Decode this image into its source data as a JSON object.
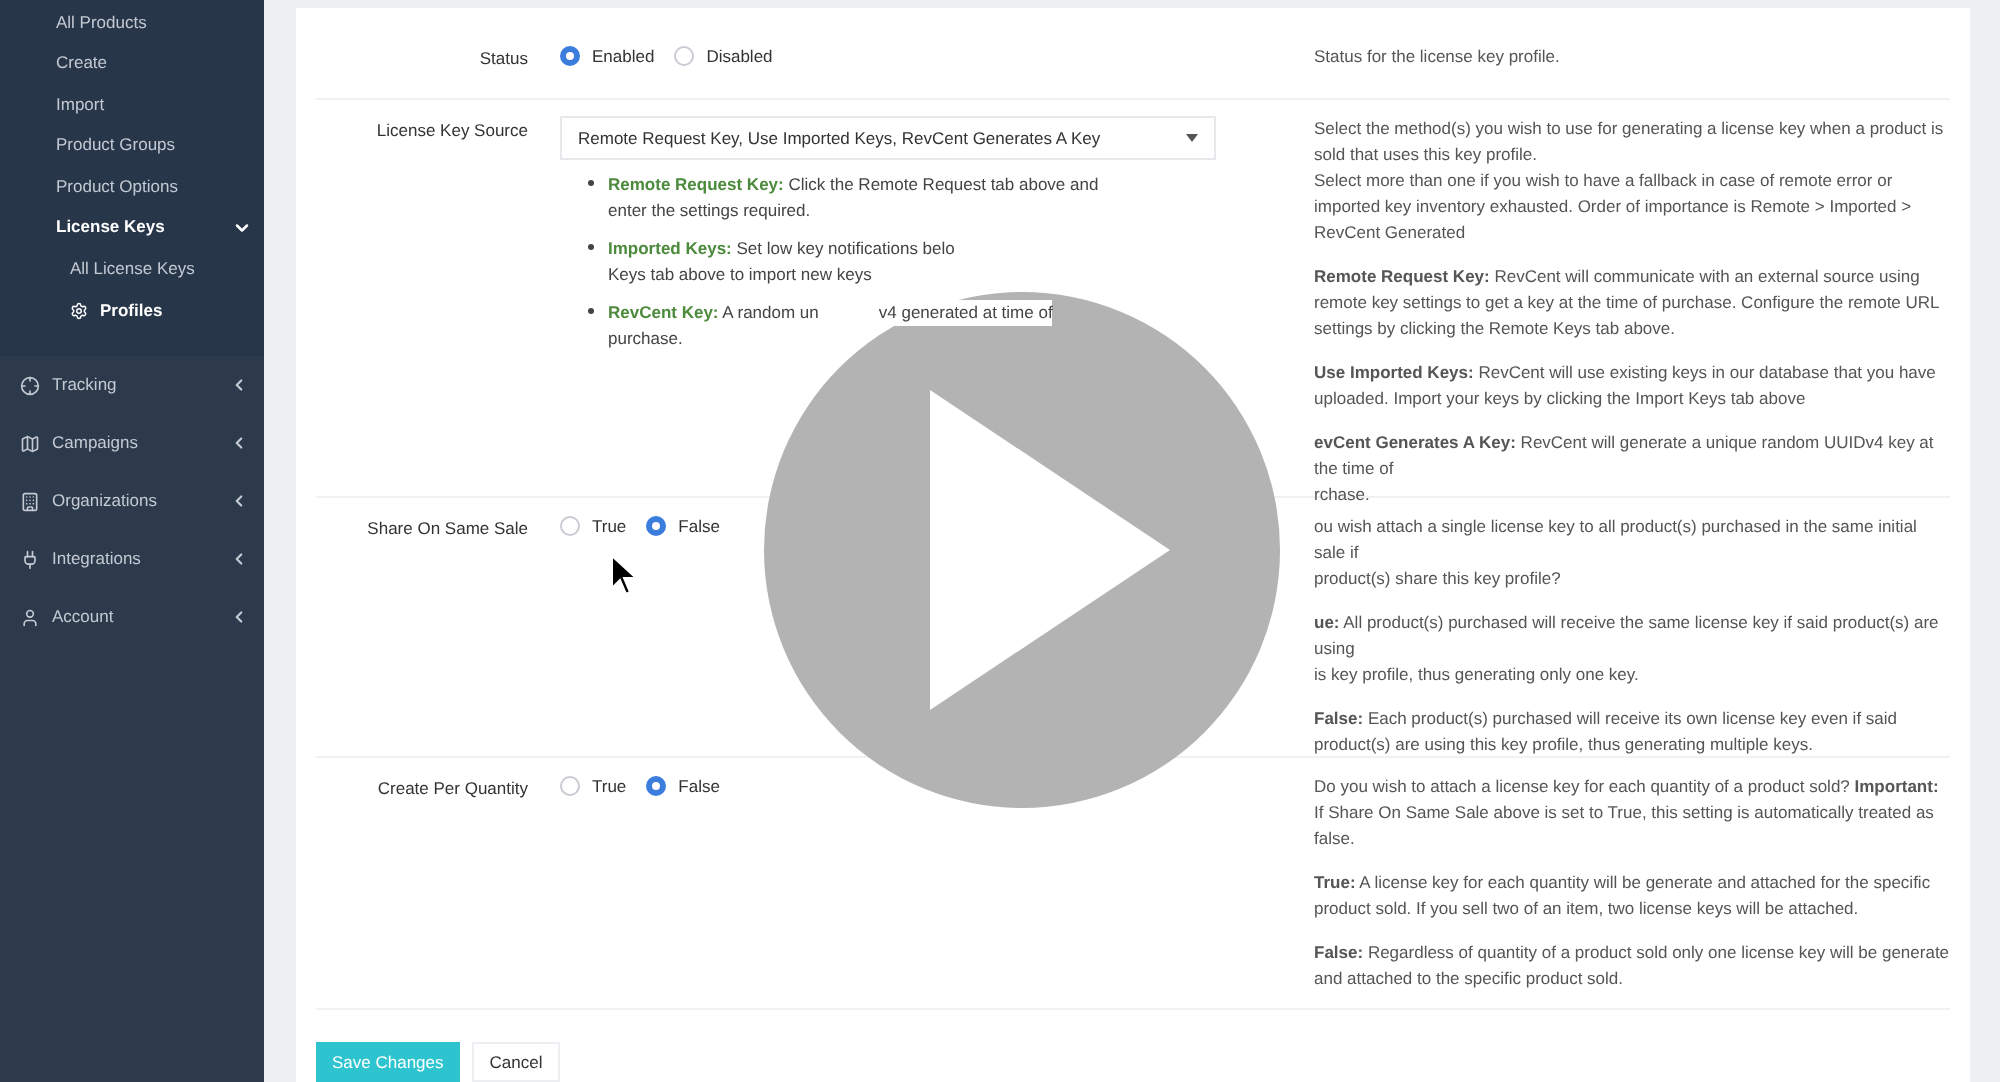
{
  "sidebar": {
    "items": [
      {
        "label": "All Products",
        "selected": false
      },
      {
        "label": "Create",
        "selected": false
      },
      {
        "label": "Import",
        "selected": false
      },
      {
        "label": "Product Groups",
        "selected": false
      },
      {
        "label": "Product Options",
        "selected": false
      },
      {
        "label": "License Keys",
        "selected": true,
        "expanded": true,
        "children": [
          {
            "label": "All License Keys",
            "selected": false
          },
          {
            "label": "Profiles",
            "selected": true
          }
        ]
      }
    ],
    "sections": [
      {
        "label": "Tracking",
        "expanded": false
      },
      {
        "label": "Campaigns",
        "expanded": false
      },
      {
        "label": "Organizations",
        "expanded": false
      },
      {
        "label": "Integrations",
        "expanded": false
      },
      {
        "label": "Account",
        "expanded": false
      }
    ]
  },
  "form": {
    "rows": [
      {
        "label": "Status",
        "kind": "radio",
        "options": [
          {
            "label": "Enabled",
            "selected": true
          },
          {
            "label": "Disabled",
            "selected": false
          }
        ],
        "description": [
          [
            "Status for the license key profile."
          ]
        ]
      },
      {
        "label": "License Key Source",
        "kind": "select",
        "value": "Remote Request Key, Use Imported Keys, RevCent Generates A Key",
        "bullets": [
          {
            "lines": [
              [
                "**Remote Request Key:** Click the Remote Request tab above and"
              ],
              [
                "enter the settings required."
              ]
            ]
          },
          {
            "lines": [
              [
                "**Imported Keys:** Set low key notifications belo"
              ],
              [
                "Keys tab above to import new keys"
              ]
            ]
          },
          {
            "lines": [
              [
                "**RevCent Key:** A random un",
                "v4 generated at time of"
              ],
              [
                "purchase."
              ]
            ]
          }
        ],
        "description": [
          [
            "Select the method(s) you wish to use for generating a license key when a product is sold that uses this key profile.",
            "Select more than one if you wish to have a fallback in case of remote error or imported key inventory exhausted. Order of importance is Remote > Imported > RevCent Generated"
          ],
          [
            "**Remote Request Key:** RevCent will communicate with an external source using remote key settings to get a key at the time of purchase. Configure the remote URL settings by clicking the Remote Keys tab above."
          ],
          [
            "**Use Imported Keys:** RevCent will use existing keys in our database that you have uploaded. Import your keys by clicking the Import Keys tab above"
          ],
          [
            "**evCent Generates A Key:** RevCent will generate a unique random UUIDv4 key at the time of",
            "rchase."
          ]
        ]
      },
      {
        "label": "Share On Same Sale",
        "kind": "radio",
        "options": [
          {
            "label": "True",
            "selected": false
          },
          {
            "label": "False",
            "selected": true
          }
        ],
        "description": [
          [
            "ou wish attach a single license key to all product(s) purchased in the same initial sale if",
            "product(s) share this key profile?"
          ],
          [
            "**ue:** All product(s) purchased will receive the same license key if said product(s) are using",
            "is key profile, thus generating only one key."
          ],
          [
            "**False:** Each product(s) purchased will receive its own license key even if said product(s) are using this key profile, thus generating multiple keys."
          ]
        ]
      },
      {
        "label": "Create Per Quantity",
        "kind": "radio",
        "options": [
          {
            "label": "True",
            "selected": false
          },
          {
            "label": "False",
            "selected": true
          }
        ],
        "description": [
          [
            "Do you wish to attach a license key for each quantity of a product sold? **Important:** If Share On Same Sale above is set to True, this setting is automatically treated as false."
          ],
          [
            "**True:** A license key for each quantity will be generate and attached for the specific product sold. If you sell two of an item, two license keys will be attached."
          ],
          [
            "**False:** Regardless of quantity of a product sold only one license key will be generate and attached to the specific product sold."
          ]
        ]
      }
    ],
    "buttons": [
      {
        "label": "Save Changes",
        "kind": "primary"
      },
      {
        "label": "Cancel",
        "kind": "secondary"
      }
    ]
  }
}
